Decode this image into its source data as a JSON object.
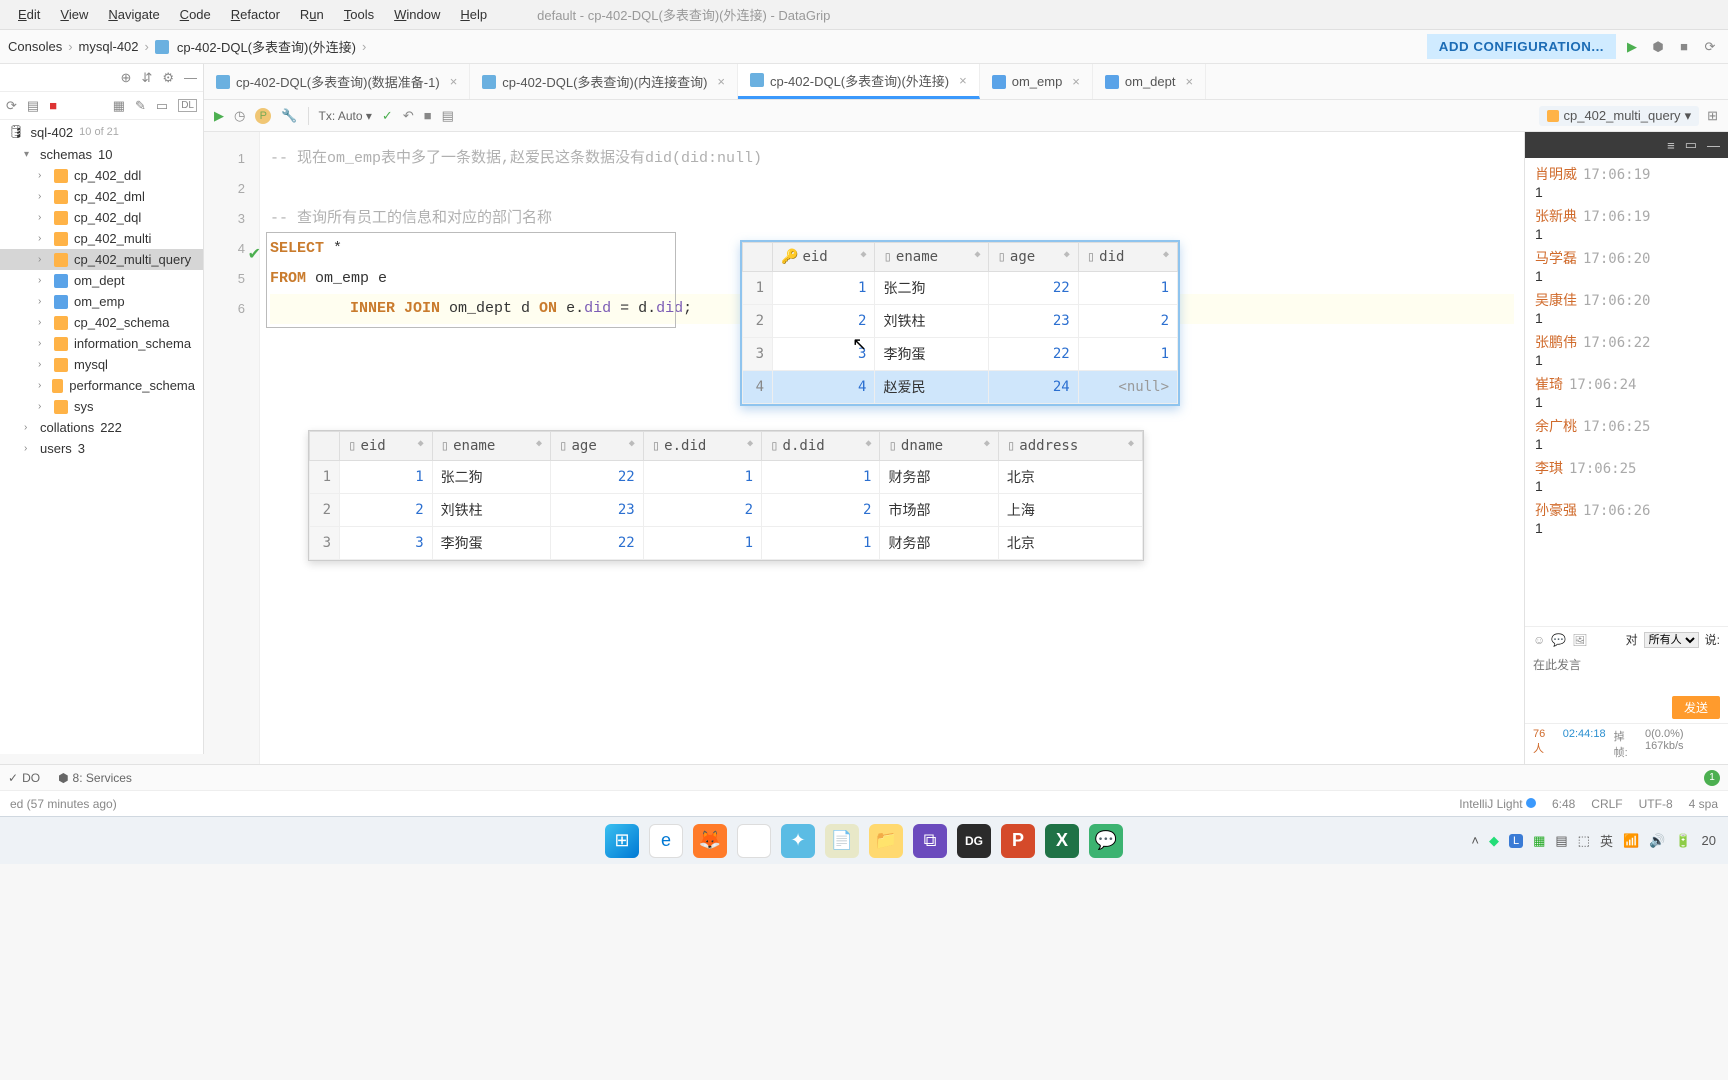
{
  "window_title": "default - cp-402-DQL(多表查询)(外连接) - DataGrip",
  "menu": [
    "Edit",
    "View",
    "Navigate",
    "Code",
    "Refactor",
    "Run",
    "Tools",
    "Window",
    "Help"
  ],
  "breadcrumb": [
    "Consoles",
    "mysql-402",
    "cp-402-DQL(多表查询)(外连接)"
  ],
  "add_conf": "ADD CONFIGURATION...",
  "sidebar": {
    "db": "sql-402",
    "db_count": "10 of 21",
    "schemas_label": "schemas",
    "schemas_count": "10",
    "items": [
      "cp_402_ddl",
      "cp_402_dml",
      "cp_402_dql",
      "cp_402_multi",
      "cp_402_multi_query",
      "om_dept",
      "om_emp",
      "cp_402_schema",
      "information_schema",
      "mysql",
      "performance_schema",
      "sys"
    ],
    "collations": "collations",
    "collations_count": "222",
    "users": "users",
    "users_count": "3"
  },
  "tabs": [
    {
      "label": "cp-402-DQL(多表查询)(数据准备-1)",
      "active": false
    },
    {
      "label": "cp-402-DQL(多表查询)(内连接查询)",
      "active": false
    },
    {
      "label": "cp-402-DQL(多表查询)(外连接)",
      "active": true
    },
    {
      "label": "om_emp",
      "active": false,
      "table": true
    },
    {
      "label": "om_dept",
      "active": false,
      "table": true
    }
  ],
  "tx": "Tx: Auto",
  "schema_badge": "cp_402_multi_query",
  "code": {
    "l1": "-- 现在om_emp表中多了一条数据,赵爱民这条数据没有did(did:null)",
    "l3": "-- 查询所有员工的信息和对应的部门名称",
    "l4a": "SELECT",
    "l4b": " *",
    "l5a": "FROM",
    "l5b": " om_emp e",
    "l6a": "INNER JOIN",
    "l6b": " om_dept d ",
    "l6c": "ON",
    "l6d": " e.",
    "l6e": "did",
    "l6f": " = d.",
    "l6g": "did",
    "l6h": ";"
  },
  "result1": {
    "cols": [
      "eid",
      "ename",
      "age",
      "did"
    ],
    "rows": [
      {
        "n": "1",
        "eid": "1",
        "ename": "张二狗",
        "age": "22",
        "did": "1"
      },
      {
        "n": "2",
        "eid": "2",
        "ename": "刘铁柱",
        "age": "23",
        "did": "2"
      },
      {
        "n": "3",
        "eid": "3",
        "ename": "李狗蛋",
        "age": "22",
        "did": "1"
      },
      {
        "n": "4",
        "eid": "4",
        "ename": "赵爱民",
        "age": "24",
        "did": "<null>"
      }
    ]
  },
  "result2": {
    "cols": [
      "eid",
      "ename",
      "age",
      "e.did",
      "d.did",
      "dname",
      "address"
    ],
    "rows": [
      {
        "n": "1",
        "eid": "1",
        "ename": "张二狗",
        "age": "22",
        "edid": "1",
        "ddid": "1",
        "dname": "财务部",
        "address": "北京"
      },
      {
        "n": "2",
        "eid": "2",
        "ename": "刘铁柱",
        "age": "23",
        "edid": "2",
        "ddid": "2",
        "dname": "市场部",
        "address": "上海"
      },
      {
        "n": "3",
        "eid": "3",
        "ename": "李狗蛋",
        "age": "22",
        "edid": "1",
        "ddid": "1",
        "dname": "财务部",
        "address": "北京"
      }
    ]
  },
  "chat": {
    "msgs": [
      {
        "name": "肖明威",
        "time": "17:06:19",
        "body": "1"
      },
      {
        "name": "张新典",
        "time": "17:06:19",
        "body": "1"
      },
      {
        "name": "马学磊",
        "time": "17:06:20",
        "body": "1"
      },
      {
        "name": "吴康佳",
        "time": "17:06:20",
        "body": "1"
      },
      {
        "name": "张鹏伟",
        "time": "17:06:22",
        "body": "1"
      },
      {
        "name": "崔琦",
        "time": "17:06:24",
        "body": "1"
      },
      {
        "name": "余广桃",
        "time": "17:06:25",
        "body": "1"
      },
      {
        "name": "李琪",
        "time": "17:06:25",
        "body": "1"
      },
      {
        "name": "孙豪强",
        "time": "17:06:26",
        "body": "1"
      }
    ],
    "to_label": "对",
    "to_value": "所有人",
    "say": "说:",
    "placeholder": "在此发言",
    "send": "发送",
    "count": "76人",
    "elapsed": "02:44:18",
    "drop_label": "掉帧:",
    "drop": "0(0.0%) 167kb/s"
  },
  "bottom": {
    "todo": "DO",
    "services": "8: Services",
    "badge": "1",
    "status_left": "ed (57 minutes ago)",
    "theme": "IntelliJ Light",
    "pos": "6:48",
    "eol": "CRLF",
    "enc": "UTF-8",
    "indent": "4 spa"
  }
}
